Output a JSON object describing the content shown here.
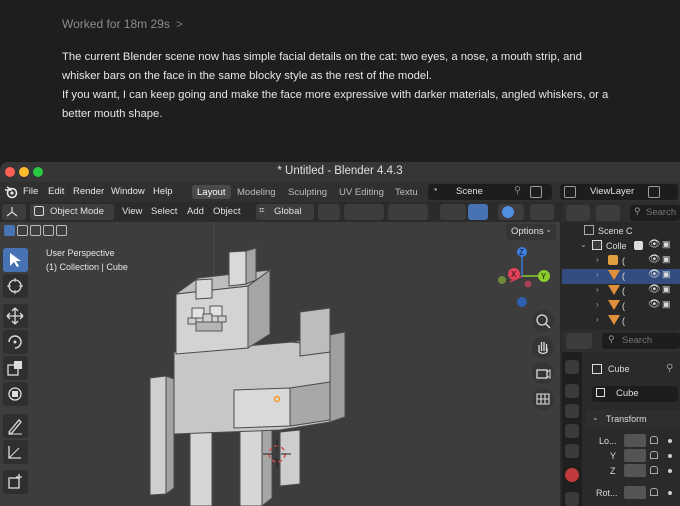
{
  "chat": {
    "worked": "Worked for 18m 29s",
    "worked_chevron": ">",
    "para1": "The current Blender scene now has simple facial details on the cat: two eyes, a nose, a mouth strip, and whisker bars on the face in the same blocky style as the rest of the model.",
    "para2": "If you want, I can keep going and make the face more expressive with darker materials, angled whiskers, or a better mouth shape."
  },
  "window": {
    "title": "* Untitled - Blender 4.4.3",
    "colors": {
      "close": "#fe5f57",
      "minimize": "#febc2e",
      "zoom": "#28c840",
      "accent": "#4772b3"
    }
  },
  "menu": {
    "items": [
      "File",
      "Edit",
      "Render",
      "Window",
      "Help"
    ],
    "workspaces": [
      "Layout",
      "Modeling",
      "Sculpting",
      "UV Editing",
      "Textu"
    ],
    "active_workspace": "Layout",
    "scene": "Scene",
    "view_layer": "ViewLayer"
  },
  "viewport_header": {
    "mode": "Object Mode",
    "menus": [
      "View",
      "Select",
      "Add",
      "Object"
    ],
    "transform_orientation": "Global",
    "options": "Options"
  },
  "viewport": {
    "perspective": "User Perspective",
    "collection_info": "(1) Collection | Cube",
    "gizmo_axes": [
      "X",
      "Y",
      "Z"
    ]
  },
  "outliner": {
    "search_placeholder": "Search",
    "scene_collection": "Scene C",
    "collection": "Colle",
    "rows": [
      "(",
      "(",
      "(",
      "(",
      "("
    ]
  },
  "properties": {
    "search_placeholder": "Search",
    "object_name": "Cube",
    "data_name": "Cube",
    "section": "Transform",
    "fields": [
      "Lo...",
      "Y",
      "Z",
      "Rot..."
    ]
  }
}
